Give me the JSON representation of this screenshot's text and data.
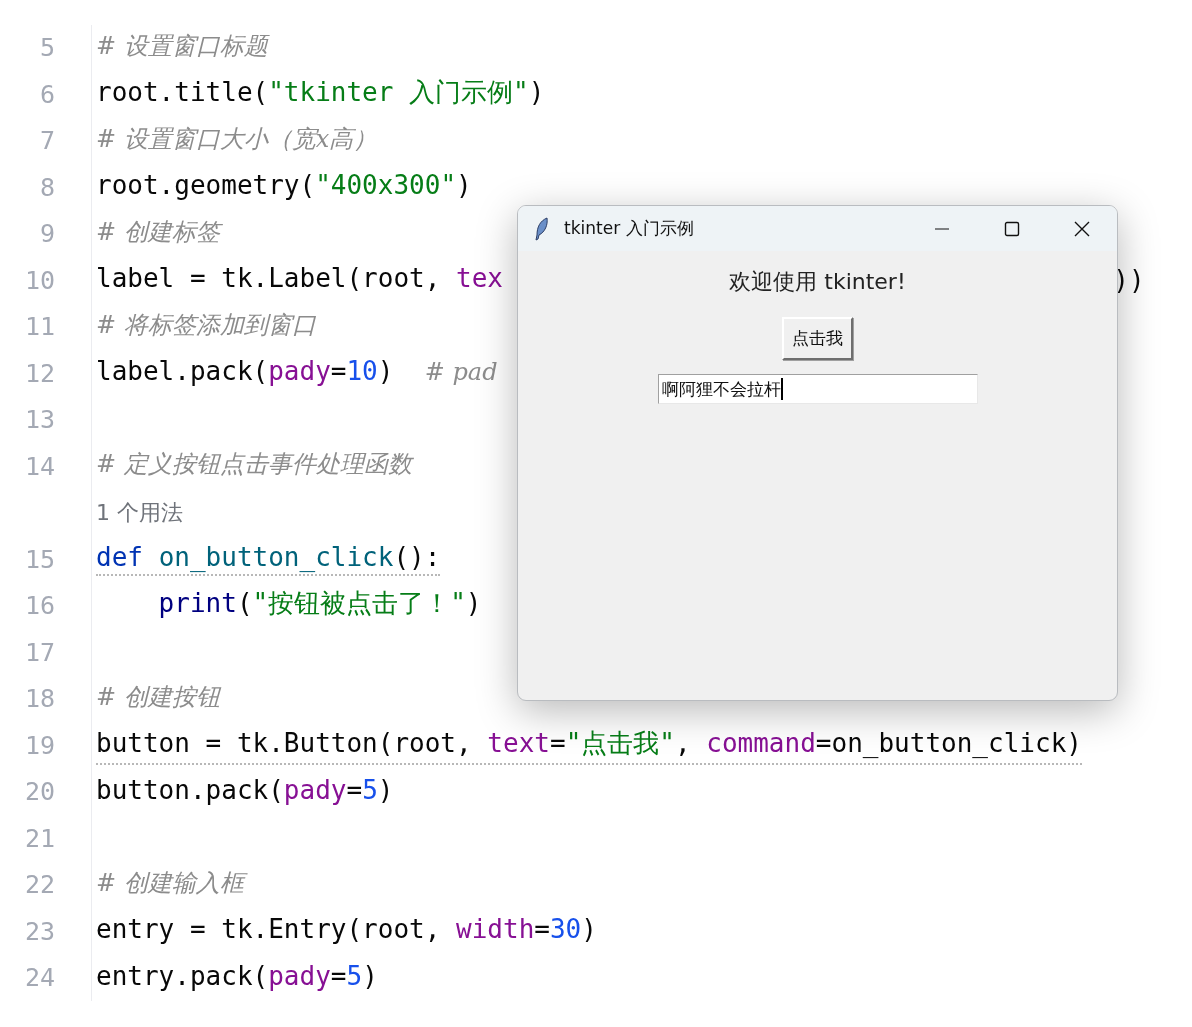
{
  "editor": {
    "lines": [
      {
        "kind": "code",
        "number": "5",
        "warned": false,
        "tokens": [
          {
            "kind": "comment",
            "text": "# 设置窗口标题"
          }
        ]
      },
      {
        "kind": "code",
        "number": "6",
        "warned": false,
        "tokens": [
          {
            "kind": "plain",
            "text": "root.title("
          },
          {
            "kind": "string",
            "text": "\"tkinter 入门示例\""
          },
          {
            "kind": "plain",
            "text": ")"
          }
        ]
      },
      {
        "kind": "code",
        "number": "7",
        "warned": false,
        "tokens": [
          {
            "kind": "comment",
            "text": "# 设置窗口大小（宽x高）"
          }
        ]
      },
      {
        "kind": "code",
        "number": "8",
        "warned": false,
        "tokens": [
          {
            "kind": "plain",
            "text": "root.geometry("
          },
          {
            "kind": "string",
            "text": "\"400x300\""
          },
          {
            "kind": "plain",
            "text": ")"
          }
        ]
      },
      {
        "kind": "code",
        "number": "9",
        "warned": false,
        "tokens": [
          {
            "kind": "comment",
            "text": "# 创建标签"
          }
        ]
      },
      {
        "kind": "code",
        "number": "10",
        "warned": false,
        "tokens": [
          {
            "kind": "plain",
            "text": "label = tk.Label(root, "
          },
          {
            "kind": "param",
            "text": "tex"
          }
        ],
        "tail": "))"
      },
      {
        "kind": "code",
        "number": "11",
        "warned": false,
        "tokens": [
          {
            "kind": "comment",
            "text": "# 将标签添加到窗口"
          }
        ]
      },
      {
        "kind": "code",
        "number": "12",
        "warned": false,
        "tokens": [
          {
            "kind": "plain",
            "text": "label.pack("
          },
          {
            "kind": "param",
            "text": "pady"
          },
          {
            "kind": "plain",
            "text": "="
          },
          {
            "kind": "number",
            "text": "10"
          },
          {
            "kind": "plain",
            "text": ")  "
          },
          {
            "kind": "comment",
            "text": "# pad"
          }
        ]
      },
      {
        "kind": "code",
        "number": "13"
      },
      {
        "kind": "code",
        "number": "14",
        "warned": false,
        "tokens": [
          {
            "kind": "comment",
            "text": "# 定义按钮点击事件处理函数"
          }
        ]
      },
      {
        "kind": "hint",
        "text": "1 个用法"
      },
      {
        "kind": "code",
        "number": "15",
        "warned": true,
        "tokens": [
          {
            "kind": "keyword",
            "text": "def "
          },
          {
            "kind": "function",
            "text": "on_button_click"
          },
          {
            "kind": "plain",
            "text": "():"
          }
        ]
      },
      {
        "kind": "code",
        "number": "16",
        "warned": false,
        "tokens": [
          {
            "kind": "builtin",
            "text": "    print"
          },
          {
            "kind": "plain",
            "text": "("
          },
          {
            "kind": "string",
            "text": "\"按钮被点击了！\""
          },
          {
            "kind": "plain",
            "text": ")"
          }
        ]
      },
      {
        "kind": "code",
        "number": "17"
      },
      {
        "kind": "code",
        "number": "18",
        "warned": false,
        "tokens": [
          {
            "kind": "comment",
            "text": "# 创建按钮"
          }
        ]
      },
      {
        "kind": "code",
        "number": "19",
        "warned": true,
        "tokens": [
          {
            "kind": "plain",
            "text": "button = tk.Button(root, "
          },
          {
            "kind": "param",
            "text": "text"
          },
          {
            "kind": "plain",
            "text": "="
          },
          {
            "kind": "string",
            "text": "\"点击我\""
          },
          {
            "kind": "plain",
            "text": ", "
          },
          {
            "kind": "param",
            "text": "command"
          },
          {
            "kind": "plain",
            "text": "=on_button_click)"
          }
        ]
      },
      {
        "kind": "code",
        "number": "20",
        "warned": false,
        "tokens": [
          {
            "kind": "plain",
            "text": "button.pack("
          },
          {
            "kind": "param",
            "text": "pady"
          },
          {
            "kind": "plain",
            "text": "="
          },
          {
            "kind": "number",
            "text": "5"
          },
          {
            "kind": "plain",
            "text": ")"
          }
        ]
      },
      {
        "kind": "code",
        "number": "21"
      },
      {
        "kind": "code",
        "number": "22",
        "warned": false,
        "tokens": [
          {
            "kind": "comment",
            "text": "# 创建输入框"
          }
        ]
      },
      {
        "kind": "code",
        "number": "23",
        "warned": false,
        "tokens": [
          {
            "kind": "plain",
            "text": "entry = tk.Entry(root, "
          },
          {
            "kind": "param",
            "text": "width"
          },
          {
            "kind": "plain",
            "text": "="
          },
          {
            "kind": "number",
            "text": "30"
          },
          {
            "kind": "plain",
            "text": ")"
          }
        ]
      },
      {
        "kind": "code",
        "number": "24",
        "warned": false,
        "tokens": [
          {
            "kind": "plain",
            "text": "entry.pack("
          },
          {
            "kind": "param",
            "text": "pady"
          },
          {
            "kind": "plain",
            "text": "="
          },
          {
            "kind": "number",
            "text": "5"
          },
          {
            "kind": "plain",
            "text": ")"
          }
        ]
      }
    ]
  },
  "window": {
    "title": "tkinter 入门示例",
    "label": "欢迎使用 tkinter!",
    "button": "点击我",
    "entry": {
      "value": "啊阿狸不会拉杆"
    }
  }
}
